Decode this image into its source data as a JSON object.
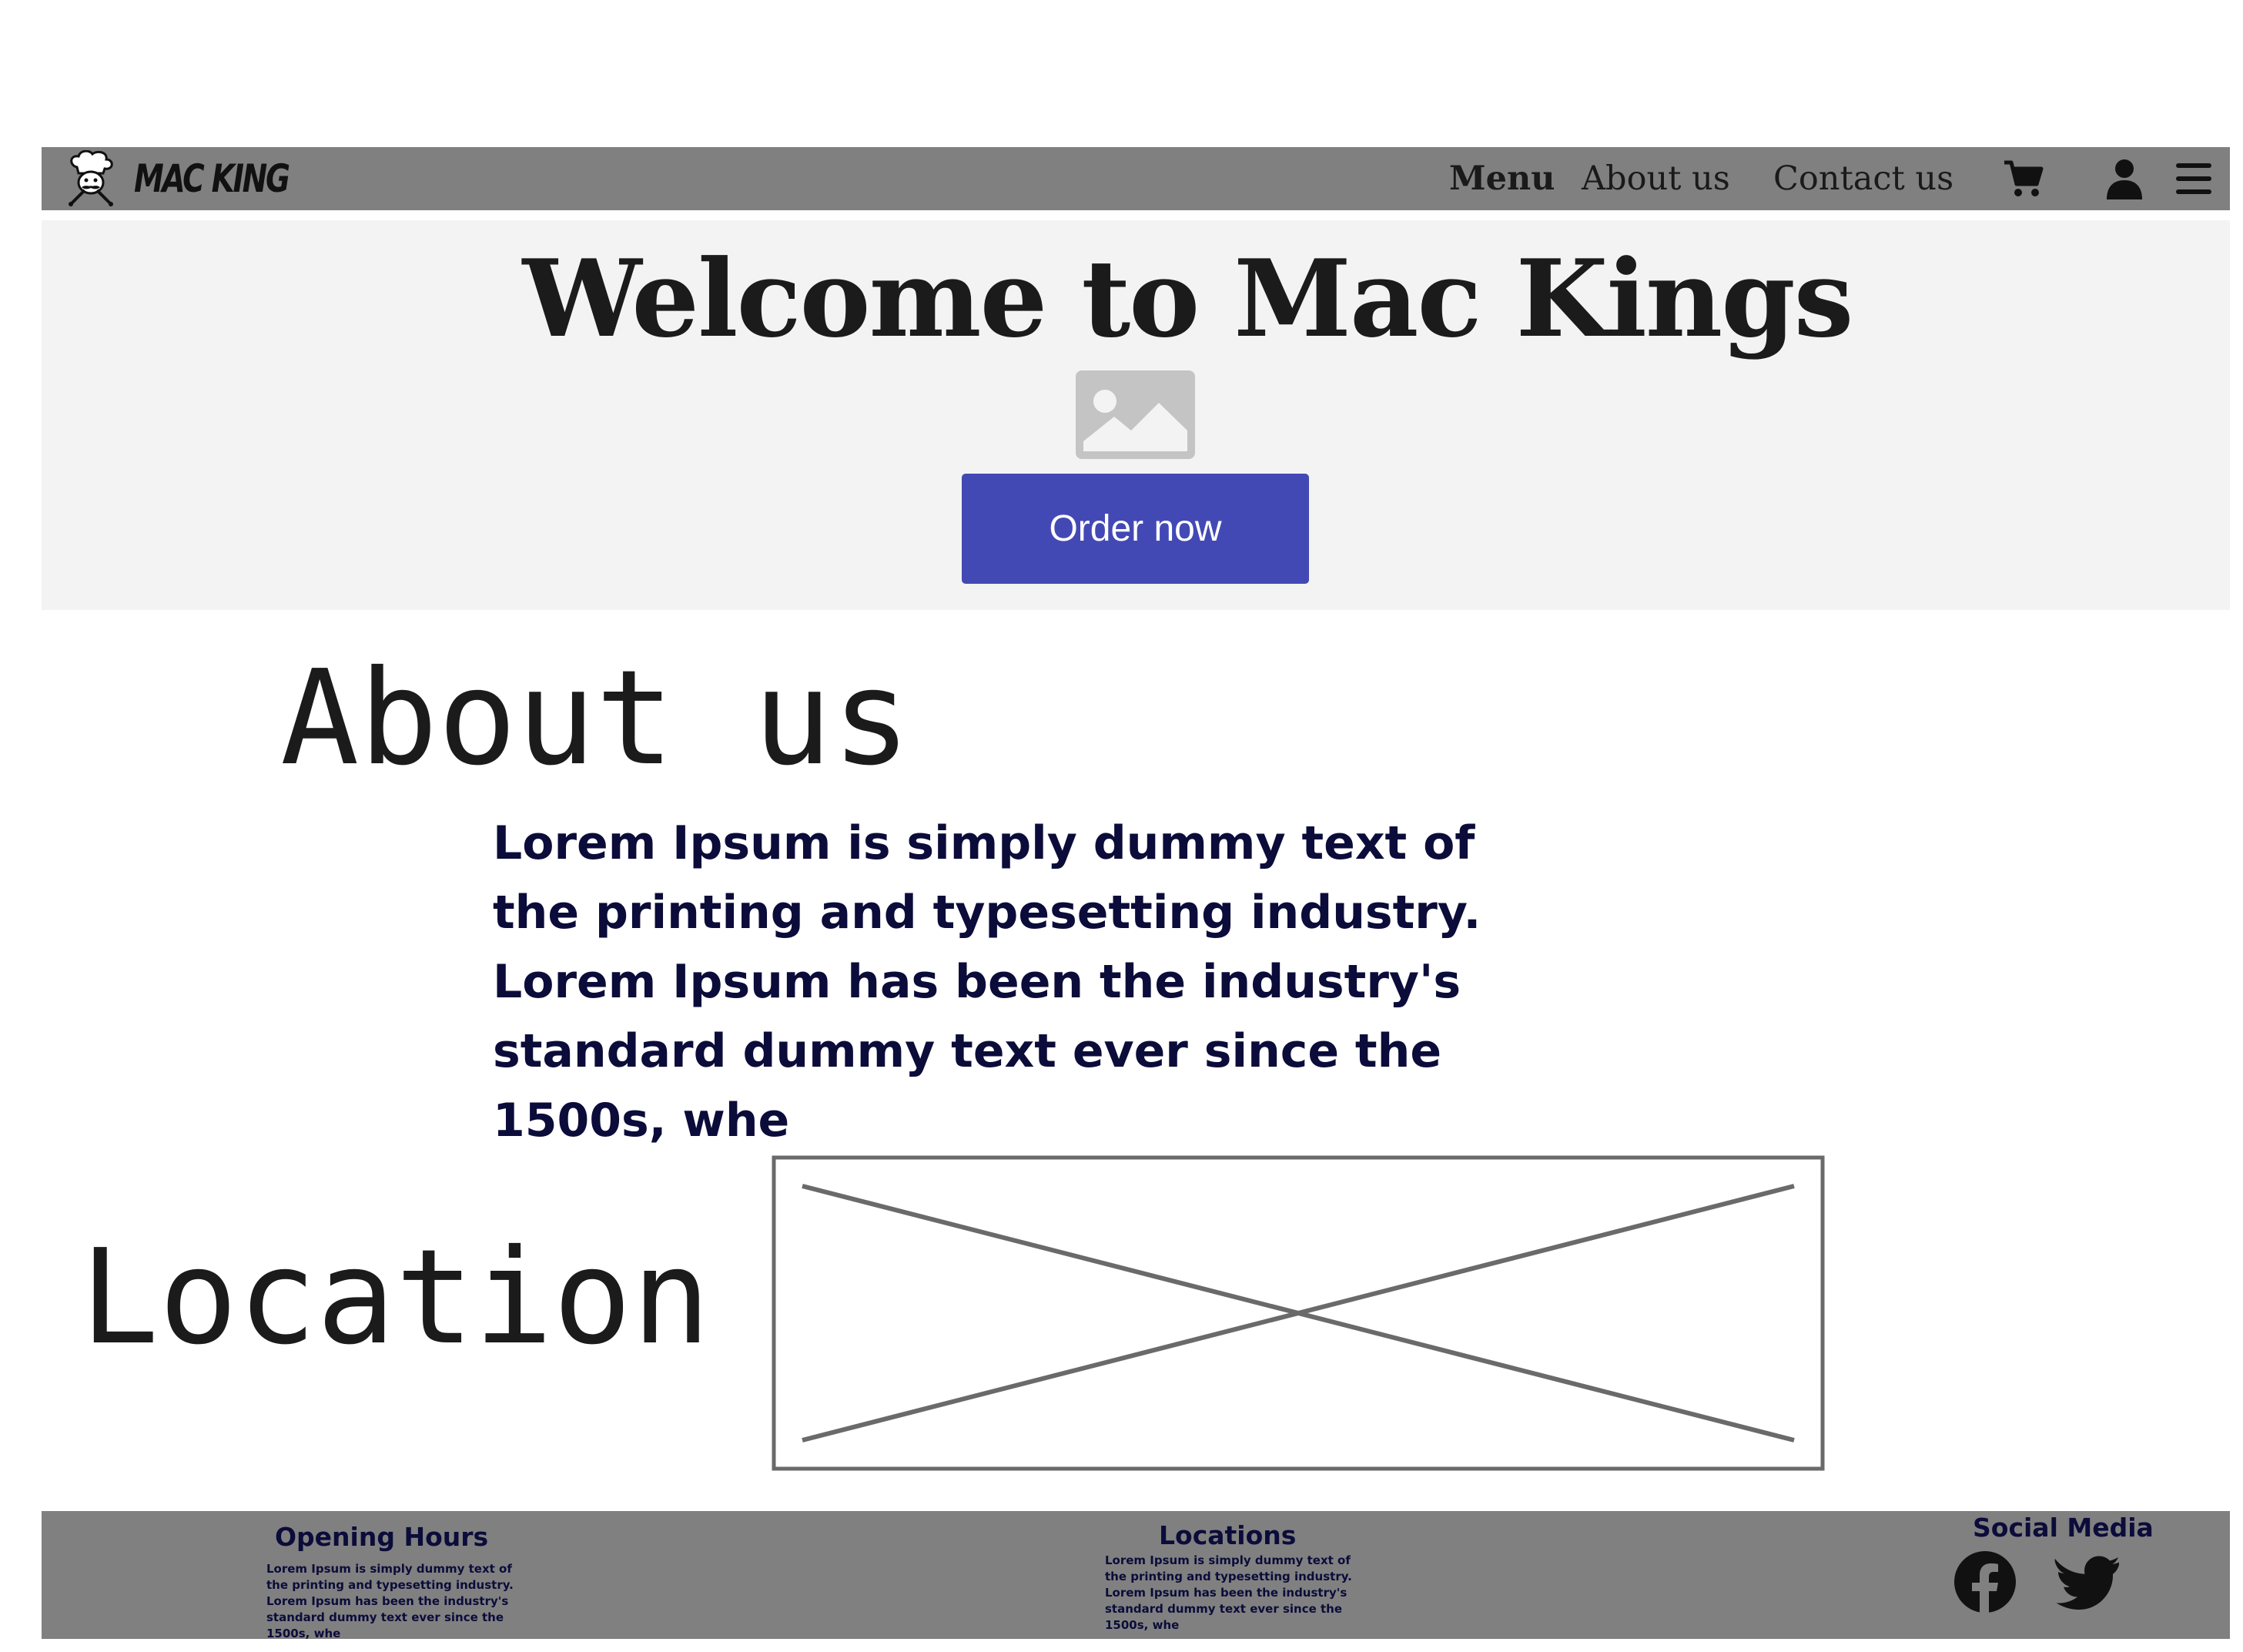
{
  "navbar": {
    "brand": "MAC KING",
    "links": [
      "Menu",
      "About us",
      "Contact us"
    ],
    "icons": [
      "cart-icon",
      "user-icon",
      "hamburger-menu-icon"
    ]
  },
  "hero": {
    "title": "Welcome to Mac Kings",
    "image_icon": "image-placeholder-icon",
    "cta_label": "Order now",
    "cta_color": "#4349b4"
  },
  "about": {
    "title": "About us",
    "text": "Lorem Ipsum is simply dummy text of the printing and typesetting industry. Lorem Ipsum has been the industry's standard dummy text ever since the 1500s, whe"
  },
  "location": {
    "title": "Location",
    "map_icon": "map-placeholder"
  },
  "footer": {
    "opening_hours": {
      "title": "Opening Hours",
      "text": "Lorem Ipsum is simply dummy text of the printing and typesetting industry. Lorem Ipsum has been the industry's standard dummy text ever since the 1500s, whe"
    },
    "locations": {
      "title": "Locations",
      "text": "Lorem Ipsum is simply dummy text of the printing and typesetting industry. Lorem Ipsum has been the industry's standard dummy text ever since the 1500s, whe"
    },
    "social": {
      "title": "Social Media",
      "icons": [
        "facebook-icon",
        "twitter-icon"
      ]
    }
  },
  "colors": {
    "navbar_bg": "#808080",
    "hero_bg": "#f3f3f3",
    "text_navy": "#0b0c3a",
    "button_blue": "#4349b4"
  }
}
